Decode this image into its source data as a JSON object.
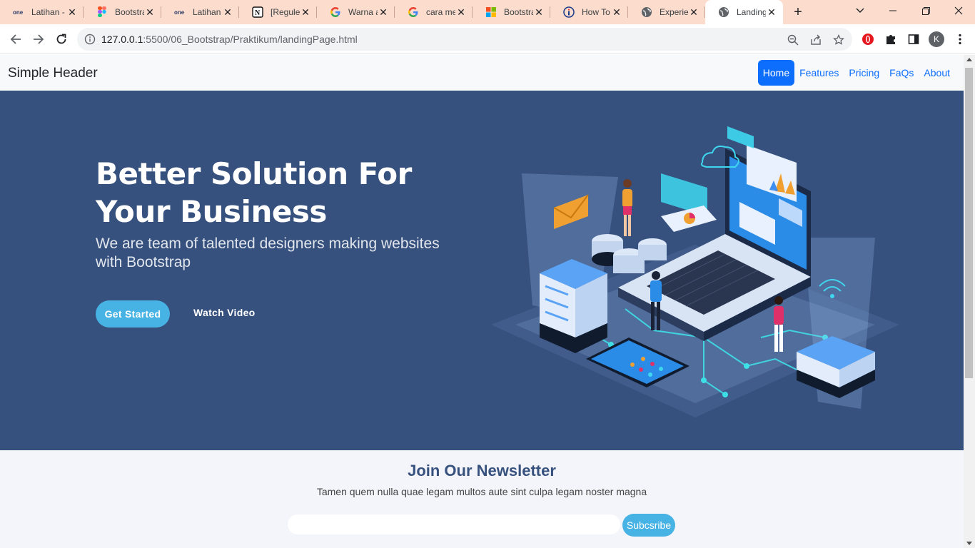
{
  "browser": {
    "tabs": [
      {
        "title": "Latihan -",
        "icon": "onenote-icon"
      },
      {
        "title": "Bootstra",
        "icon": "figma-icon"
      },
      {
        "title": "Latihan -",
        "icon": "onenote-icon"
      },
      {
        "title": "[Reguler",
        "icon": "notion-icon"
      },
      {
        "title": "Warna a",
        "icon": "google-icon"
      },
      {
        "title": "cara mer",
        "icon": "google-icon"
      },
      {
        "title": "Bootstra",
        "icon": "microsoft-icon"
      },
      {
        "title": "How To",
        "icon": "info-icon"
      },
      {
        "title": "Experien",
        "icon": "globe-icon"
      },
      {
        "title": "Landing",
        "icon": "globe-icon"
      }
    ],
    "active_tab_index": 9,
    "url_host": "127.0.0.1",
    "url_rest": ":5500/06_Bootstrap/Praktikum/landingPage.html",
    "profile_initial": "K",
    "tabbar_color": "#fbdccd"
  },
  "site": {
    "brand": "Simple Header",
    "nav": [
      "Home",
      "Features",
      "Pricing",
      "FaQs",
      "About"
    ],
    "active_nav_index": 0,
    "colors": {
      "primary": "#0d6efd",
      "hero": "#37517e",
      "accent": "#47b2e4"
    }
  },
  "hero": {
    "title": "Better Solution For Your Business",
    "subtitle": "We are team of talented designers making websites with Bootstrap",
    "cta_primary": "Get Started",
    "cta_secondary": "Watch Video"
  },
  "newsletter": {
    "title": "Join Our Newsletter",
    "text": "Tamen quem nulla quae legam multos aute sint culpa legam noster magna",
    "input_value": "",
    "button": "Subcsribe"
  }
}
